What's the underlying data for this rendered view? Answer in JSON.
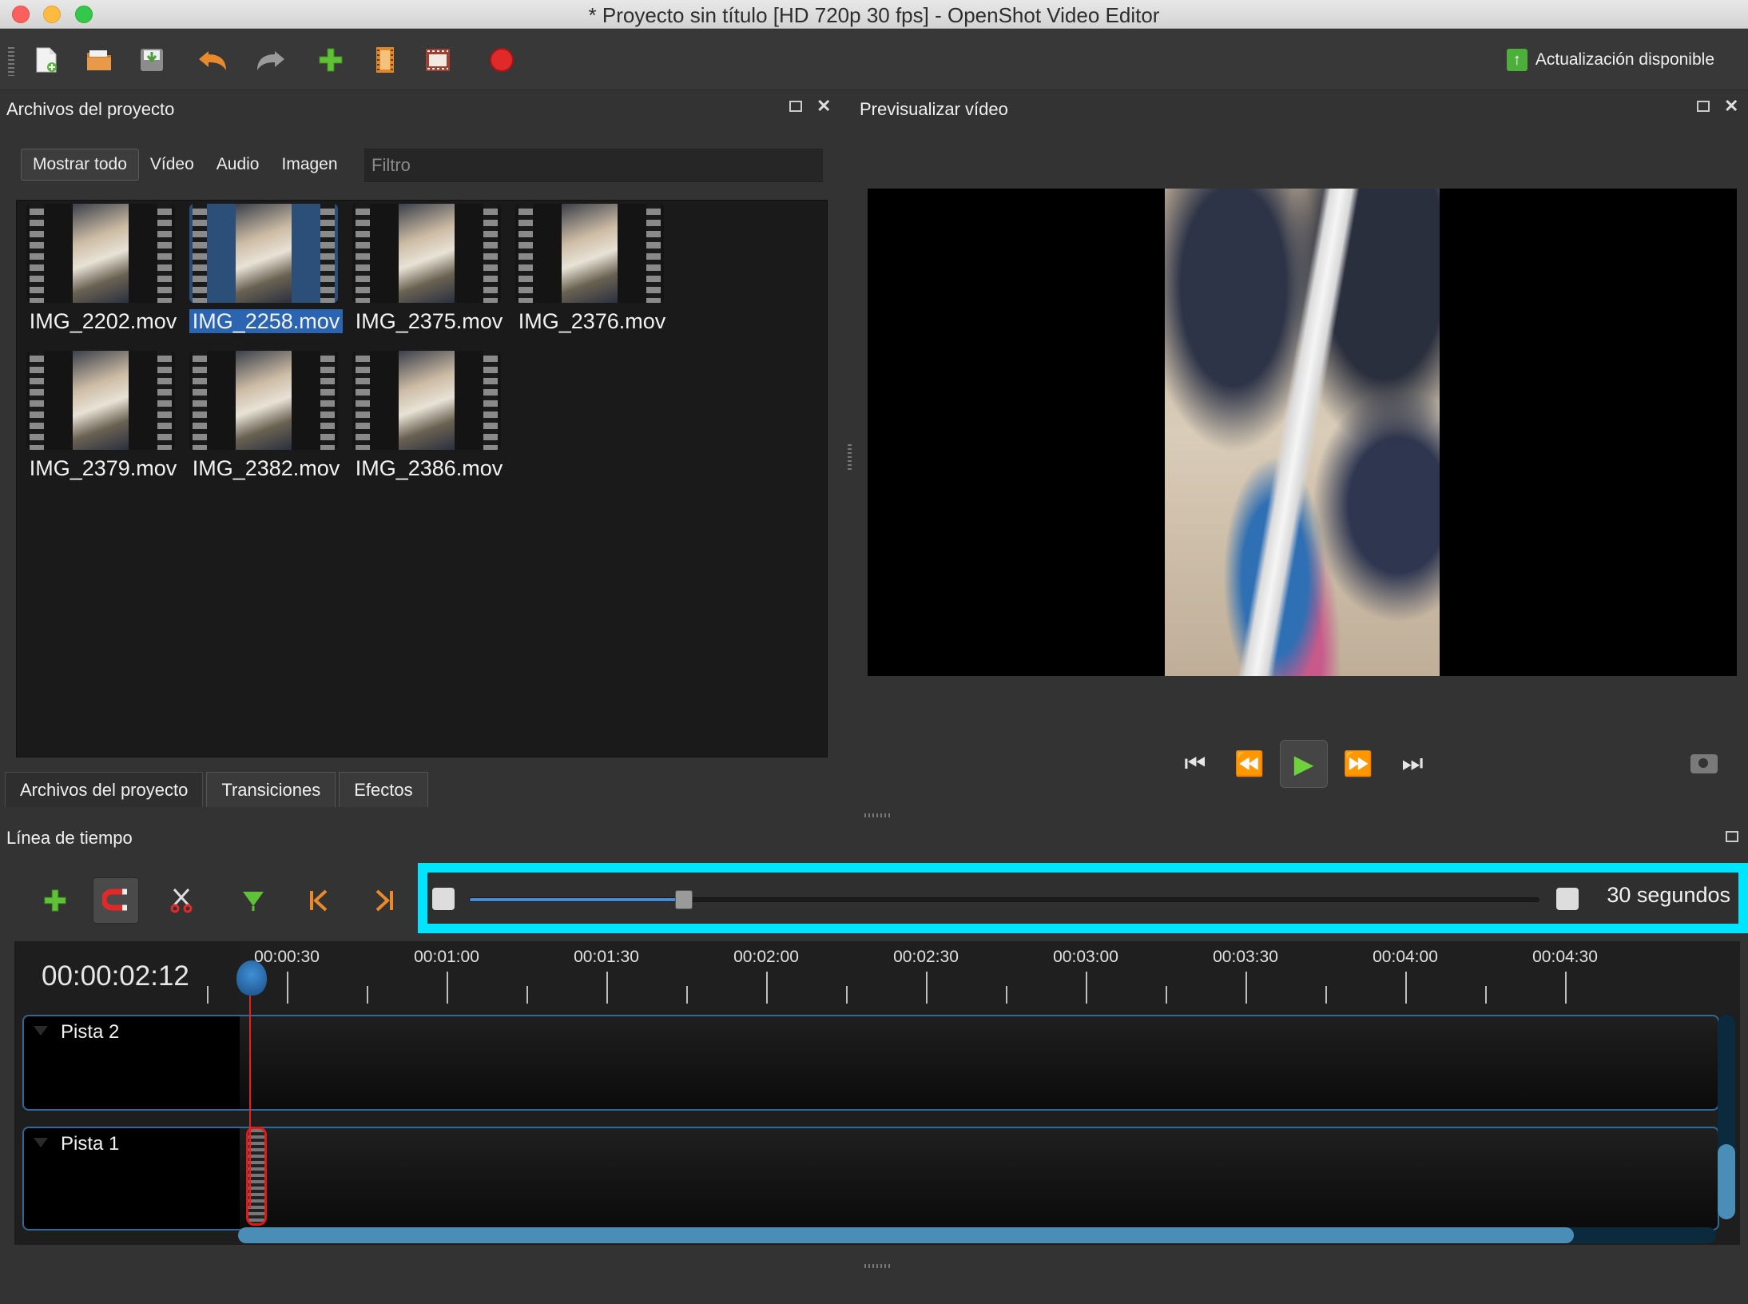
{
  "window": {
    "title": "* Proyecto sin título [HD 720p 30 fps] - OpenShot Video Editor"
  },
  "toolbar": {
    "buttons": [
      {
        "name": "new-project-icon"
      },
      {
        "name": "open-project-icon"
      },
      {
        "name": "save-project-icon"
      },
      {
        "name": "undo-icon"
      },
      {
        "name": "redo-icon"
      },
      {
        "name": "import-files-icon"
      },
      {
        "name": "choose-profile-icon"
      },
      {
        "name": "fullscreen-icon"
      },
      {
        "name": "export-video-icon"
      }
    ],
    "update_label": "Actualización disponible"
  },
  "project_files": {
    "title": "Archivos del proyecto",
    "filters": [
      "Mostrar todo",
      "Vídeo",
      "Audio",
      "Imagen"
    ],
    "active_filter": "Mostrar todo",
    "filter_placeholder": "Filtro",
    "files": [
      {
        "name": "IMG_2202.mov",
        "selected": false
      },
      {
        "name": "IMG_2258.mov",
        "selected": true
      },
      {
        "name": "IMG_2375.mov",
        "selected": false
      },
      {
        "name": "IMG_2376.mov",
        "selected": false
      },
      {
        "name": "IMG_2379.mov",
        "selected": false
      },
      {
        "name": "IMG_2382.mov",
        "selected": false
      },
      {
        "name": "IMG_2386.mov",
        "selected": false
      }
    ],
    "tabs": [
      "Archivos del proyecto",
      "Transiciones",
      "Efectos"
    ],
    "active_tab": "Archivos del proyecto"
  },
  "preview": {
    "title": "Previsualizar vídeo"
  },
  "timeline": {
    "title": "Línea de tiempo",
    "current_time": "00:00:02:12",
    "zoom_label": "30 segundos",
    "zoom_value": 0.2,
    "ruler_labels": [
      "00:00:30",
      "00:01:00",
      "00:01:30",
      "00:02:00",
      "00:02:30",
      "00:03:00",
      "00:03:30",
      "00:04:00",
      "00:04:30"
    ],
    "tracks": [
      {
        "name": "Pista 2"
      },
      {
        "name": "Pista 1"
      }
    ]
  },
  "colors": {
    "highlight": "#00e5ff",
    "selection": "#2b64b0",
    "play_green": "#6fd13c",
    "playhead_red": "#e52222"
  }
}
